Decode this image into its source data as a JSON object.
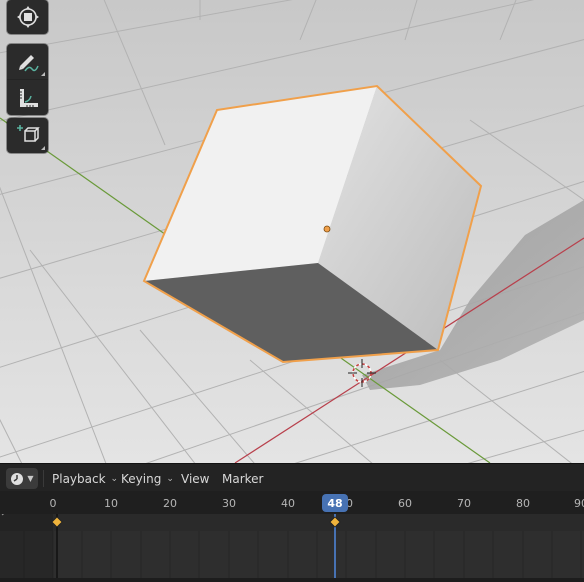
{
  "timeline": {
    "menus": [
      {
        "label": "Playback"
      },
      {
        "label": "Keying"
      },
      {
        "label": "View"
      },
      {
        "label": "Marker"
      }
    ],
    "ruler": {
      "labels": [
        "0",
        "10",
        "20",
        "30",
        "40",
        "50",
        "60",
        "70",
        "80",
        "90"
      ]
    },
    "current_frame": "48",
    "keyframes": [
      0,
      48
    ]
  },
  "toolbar": {
    "tools": [
      "transform-tool",
      "annotate-tool",
      "measure-tool",
      "add-cube-tool"
    ]
  },
  "colors": {
    "selection_outline": "#f0a04b",
    "x_axis": "#b8404c",
    "y_axis": "#6a9a3a",
    "current_frame": "#4772b3",
    "keyframe": "#f0b43c"
  }
}
